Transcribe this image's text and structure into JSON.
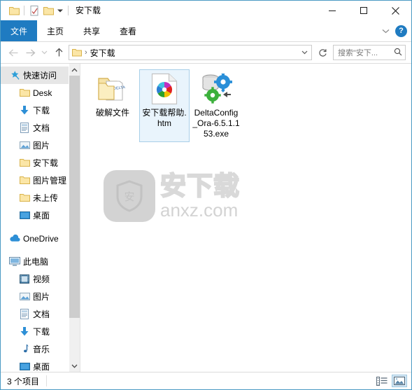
{
  "window": {
    "title": "安下载",
    "controls": {
      "minimize": "minimize-icon",
      "maximize": "maximize-icon",
      "close": "close-icon"
    },
    "quick_access": [
      {
        "name": "folder-icon",
        "label": ""
      },
      {
        "name": "properties-icon",
        "label": ""
      },
      {
        "name": "new-folder-icon",
        "label": ""
      },
      {
        "name": "chevron-down-icon",
        "label": ""
      }
    ]
  },
  "ribbon": {
    "tabs": [
      {
        "label": "文件",
        "selected": true
      },
      {
        "label": "主页",
        "selected": false
      },
      {
        "label": "共享",
        "selected": false
      },
      {
        "label": "查看",
        "selected": false
      }
    ],
    "expand_icon": "chevron-down-icon",
    "help_label": "?"
  },
  "address": {
    "back_icon": "arrow-left-icon",
    "forward_icon": "arrow-right-icon",
    "recent_icon": "chevron-down-icon",
    "up_icon": "arrow-up-icon",
    "crumb_separator": "›",
    "path_label": "安下载",
    "dropdown_icon": "chevron-down-icon",
    "refresh_icon": "refresh-icon"
  },
  "search": {
    "placeholder": "搜索\"安下...",
    "icon": "search-icon"
  },
  "sidebar": {
    "items": [
      {
        "label": "快速访问",
        "icon": "star-pin-icon",
        "level": 1,
        "selected": true,
        "pinned": false
      },
      {
        "label": "Desk",
        "icon": "folder-icon",
        "level": 2,
        "selected": false,
        "pinned": true
      },
      {
        "label": "下载",
        "icon": "download-arrow-icon",
        "level": 2,
        "selected": false,
        "pinned": true
      },
      {
        "label": "文档",
        "icon": "documents-icon",
        "level": 2,
        "selected": false,
        "pinned": true
      },
      {
        "label": "图片",
        "icon": "pictures-icon",
        "level": 2,
        "selected": false,
        "pinned": true
      },
      {
        "label": "安下载",
        "icon": "folder-icon",
        "level": 2,
        "selected": false,
        "pinned": false
      },
      {
        "label": "图片管理",
        "icon": "folder-icon",
        "level": 2,
        "selected": false,
        "pinned": false
      },
      {
        "label": "未上传",
        "icon": "folder-icon",
        "level": 2,
        "selected": false,
        "pinned": false
      },
      {
        "label": "桌面",
        "icon": "desktop-icon",
        "level": 2,
        "selected": false,
        "pinned": false
      },
      {
        "label": "OneDrive",
        "icon": "onedrive-cloud-icon",
        "level": 1,
        "selected": false,
        "pinned": false
      },
      {
        "label": "此电脑",
        "icon": "this-pc-icon",
        "level": 1,
        "selected": false,
        "pinned": false
      },
      {
        "label": "视频",
        "icon": "videos-icon",
        "level": 2,
        "selected": false,
        "pinned": false
      },
      {
        "label": "图片",
        "icon": "pictures-icon",
        "level": 2,
        "selected": false,
        "pinned": false
      },
      {
        "label": "文档",
        "icon": "documents-icon",
        "level": 2,
        "selected": false,
        "pinned": false
      },
      {
        "label": "下载",
        "icon": "download-arrow-icon",
        "level": 2,
        "selected": false,
        "pinned": false
      },
      {
        "label": "音乐",
        "icon": "music-icon",
        "level": 2,
        "selected": false,
        "pinned": false
      },
      {
        "label": "桌面",
        "icon": "desktop-icon",
        "level": 2,
        "selected": false,
        "pinned": false
      }
    ],
    "scroll_up_icon": "chevron-up-icon",
    "scroll_down_icon": "chevron-down-icon"
  },
  "files": [
    {
      "name": "破解文件",
      "icon": "folder-with-file-icon",
      "selected": false
    },
    {
      "name": "安下载帮助.htm",
      "icon": "html-pinwheel-document-icon",
      "selected": true
    },
    {
      "name": "DeltaConfig_Ora-6.5.1.153.exe",
      "icon": "database-gears-exe-icon",
      "selected": false
    }
  ],
  "watermark": {
    "badge_char": "安",
    "brand": "安下载",
    "url": "anxz.com",
    "color": "#d3d3d3"
  },
  "status": {
    "item_count_label": "3 个项目",
    "views": [
      {
        "name": "details-view",
        "active": false
      },
      {
        "name": "large-icons-view",
        "active": true
      }
    ]
  },
  "colors": {
    "accent": "#1f7bc1",
    "window_border": "#4a9ac4",
    "selection_bg": "#e9f4fc",
    "selection_border": "#a8cfe8"
  }
}
